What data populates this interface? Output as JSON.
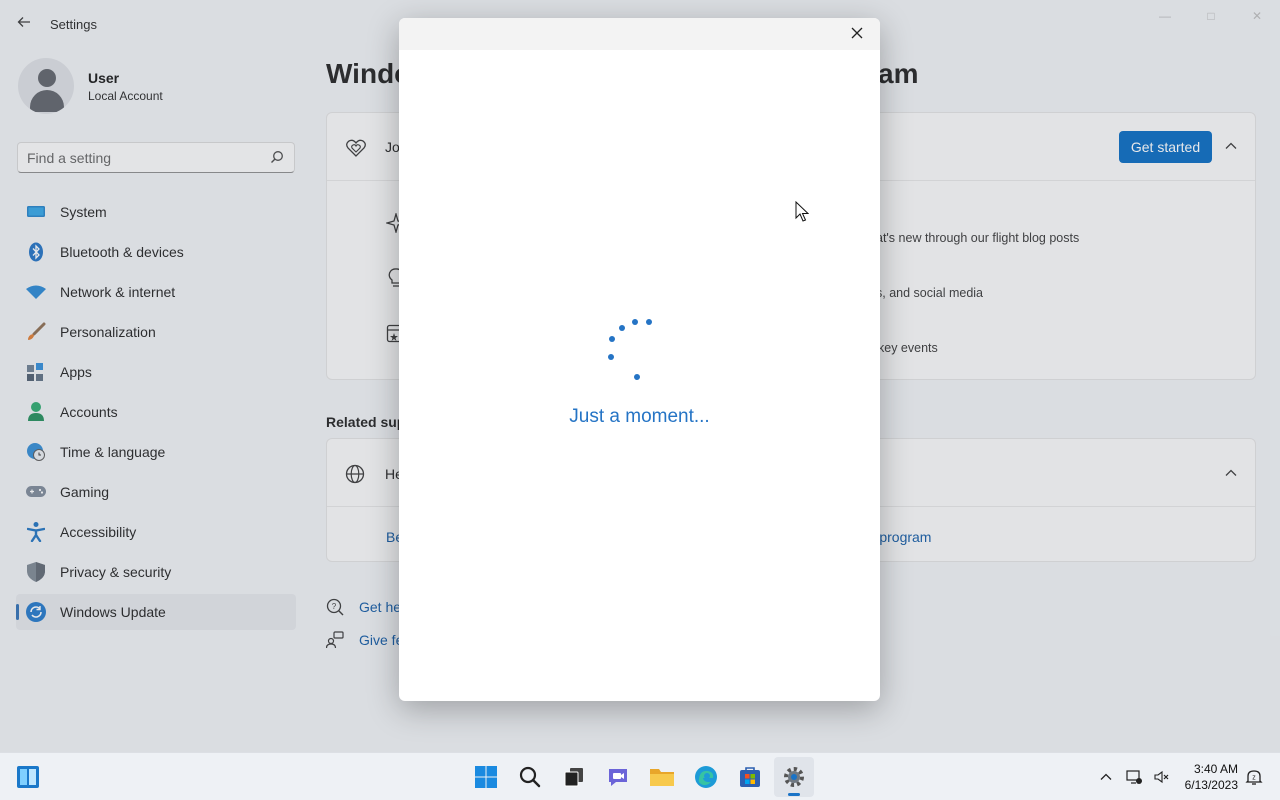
{
  "window": {
    "title": "Settings"
  },
  "profile": {
    "name": "User",
    "account_type": "Local Account"
  },
  "search": {
    "placeholder": "Find a setting"
  },
  "sidebar": {
    "items": [
      {
        "label": "System",
        "icon": "monitor-icon"
      },
      {
        "label": "Bluetooth & devices",
        "icon": "bluetooth-icon"
      },
      {
        "label": "Network & internet",
        "icon": "wifi-icon"
      },
      {
        "label": "Personalization",
        "icon": "brush-icon"
      },
      {
        "label": "Apps",
        "icon": "apps-icon"
      },
      {
        "label": "Accounts",
        "icon": "person-icon"
      },
      {
        "label": "Time & language",
        "icon": "globe-clock-icon"
      },
      {
        "label": "Gaming",
        "icon": "gamepad-icon"
      },
      {
        "label": "Accessibility",
        "icon": "accessibility-icon"
      },
      {
        "label": "Privacy & security",
        "icon": "shield-icon"
      },
      {
        "label": "Windows Update",
        "icon": "update-icon",
        "active": true
      }
    ]
  },
  "main": {
    "title_start": "Windo",
    "title_end": "am",
    "join_card": {
      "title_partial": "Jo",
      "button": "Get started",
      "rows": [
        "at's new through our flight blog posts",
        "s, and social media",
        "key events"
      ]
    },
    "related_heading": "Related sup",
    "help_card": {
      "title_partial": "He",
      "link_left": "Be",
      "link_right": "er program"
    },
    "links": [
      {
        "label": "Get he",
        "icon": "help-icon"
      },
      {
        "label": "Give fe",
        "icon": "feedback-icon"
      }
    ]
  },
  "dialog": {
    "status": "Just a moment..."
  },
  "taskbar": {
    "apps": [
      {
        "name": "start-button",
        "icon": "windows-logo-icon"
      },
      {
        "name": "search-button",
        "icon": "search-icon"
      },
      {
        "name": "task-view-button",
        "icon": "task-view-icon"
      },
      {
        "name": "teams-button",
        "icon": "chat-icon"
      },
      {
        "name": "file-explorer-button",
        "icon": "folder-icon"
      },
      {
        "name": "edge-button",
        "icon": "edge-icon"
      },
      {
        "name": "store-button",
        "icon": "store-icon"
      },
      {
        "name": "settings-button",
        "icon": "gear-icon",
        "active": true
      }
    ],
    "time": "3:40 AM",
    "date": "6/13/2023"
  },
  "colors": {
    "accent": "#0067c0",
    "spinner": "#2574c5",
    "link": "#0b56a3"
  }
}
